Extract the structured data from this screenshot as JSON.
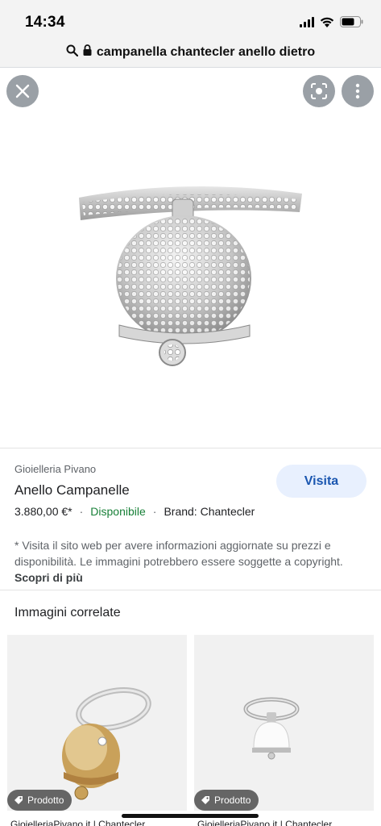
{
  "status_bar": {
    "time": "14:34"
  },
  "search": {
    "query": "campanella chantecler anello dietro"
  },
  "product": {
    "source": "Gioielleria Pivano",
    "title": "Anello Campanelle",
    "price": "3.880,00 €*",
    "availability": "Disponibile",
    "brand": "Brand: Chantecler",
    "visit_label": "Visita"
  },
  "disclaimer": {
    "text": "* Visita il sito web per avere informazioni aggiornate su prezzi e disponibilità. Le immagini potrebbero essere soggette a copyright.",
    "link": "Scopri di più"
  },
  "related": {
    "heading": "Immagini correlate",
    "items": [
      {
        "chip": "Prodotto",
        "source": "GioielleriaPivano.it | Chantecler"
      },
      {
        "chip": "Prodotto",
        "source": "GioielleriaPivano.it | Chantecler"
      }
    ]
  },
  "colors": {
    "accent": "#1a56b0",
    "available": "#188038",
    "visit_bg": "#e8f0fe"
  }
}
